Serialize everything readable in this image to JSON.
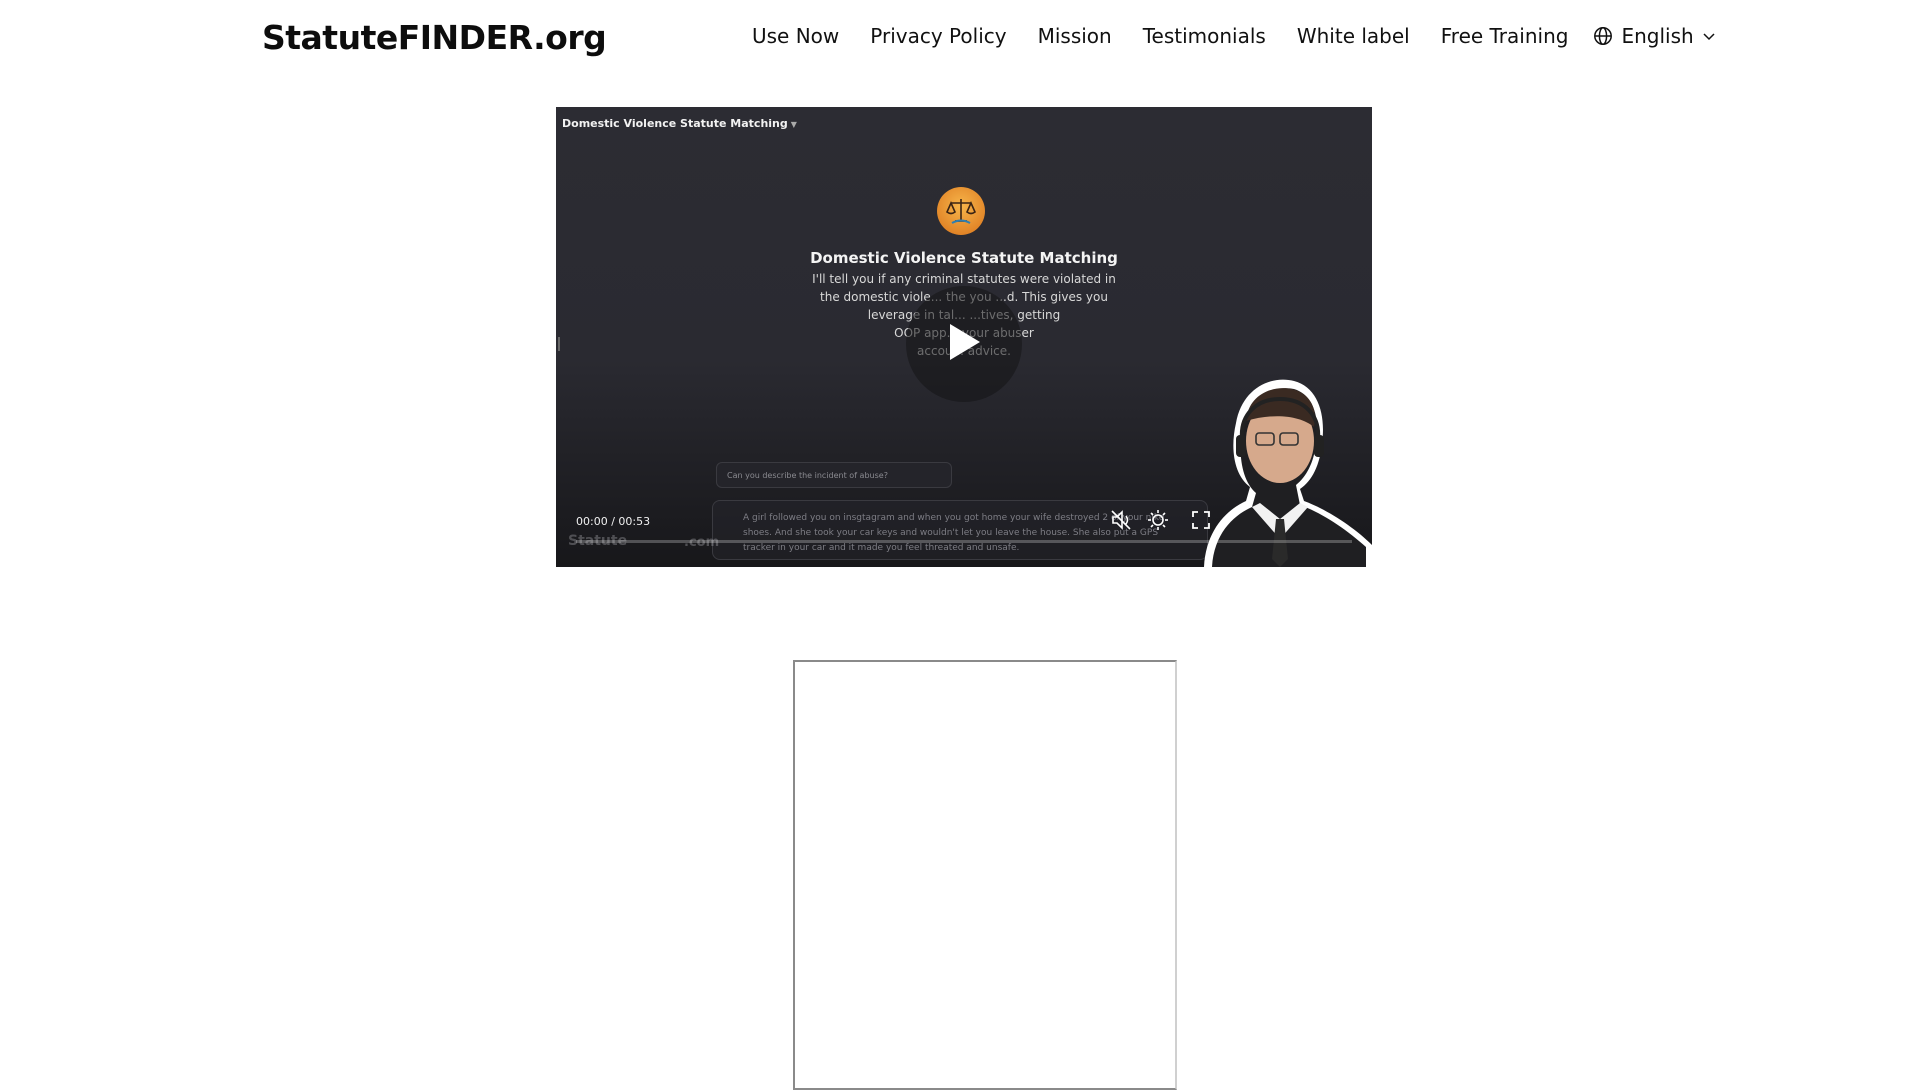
{
  "header": {
    "logo": "StatuteFINDER.org",
    "nav": [
      {
        "label": "Use Now",
        "name": "nav-use-now"
      },
      {
        "label": "Privacy Policy",
        "name": "nav-privacy-policy"
      },
      {
        "label": "Mission",
        "name": "nav-mission"
      },
      {
        "label": "Testimonials",
        "name": "nav-testimonials"
      },
      {
        "label": "White label",
        "name": "nav-white-label"
      },
      {
        "label": "Free Training",
        "name": "nav-free-training"
      }
    ],
    "language": {
      "label": "English",
      "icon": "globe-icon"
    }
  },
  "video": {
    "top_title": "Domestic Violence Statute Matching",
    "gpt_title": "Domestic Violence Statute Matching",
    "gpt_description_lines": [
      "I'll tell you if any criminal statutes were violated in",
      "the domestic viole... the you ...d. This gives you",
      "leverage in tal... ...tives, getting",
      "OOP app... your abuser",
      "accou... advice."
    ],
    "chat_question": "Can you describe the incident of abuse?",
    "chat_answer": "A girl followed you on insgtagram and when you got home your wife destroyed 2 of your nike shoes. And she took your car keys and wouldn't let you leave the house. She also put a GPS tracker in your car and it made you feel threated and unsafe.",
    "watermark_left": "Statute",
    "watermark_right": ".com",
    "time_current": "00:00",
    "time_total": "00:53",
    "time_text": "00:00 / 00:53",
    "progress": 0,
    "muted": true,
    "controls": [
      "mute-icon",
      "settings-icon",
      "fullscreen-icon"
    ]
  },
  "colors": {
    "video_bg": "#2b2b30",
    "scales_logo": "#e8902c",
    "text_dark": "#111111"
  }
}
